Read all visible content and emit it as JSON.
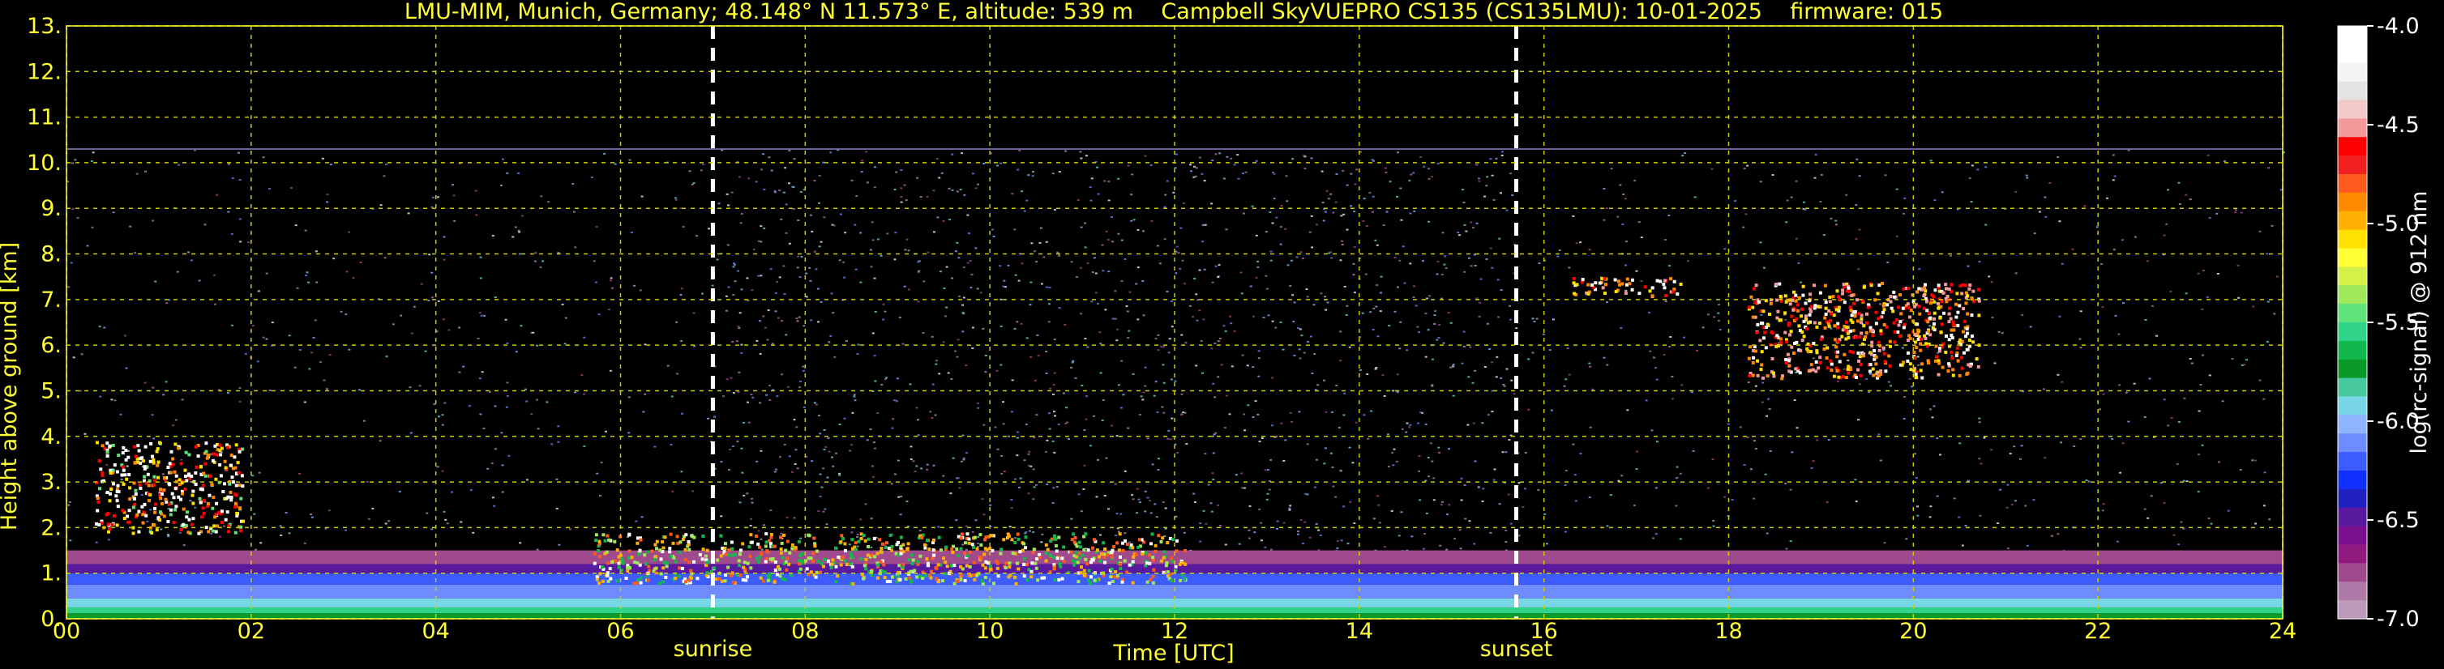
{
  "header": {
    "title": "LMU-MIM, Munich, Germany; 48.148° N 11.573° E, altitude: 539 m    Campbell SkyVUEPRO CS135 (CS135LMU): 10-01-2025    firmware: 015"
  },
  "chart_data": {
    "type": "heatmap",
    "title": "LMU-MIM, Munich, Germany; 48.148° N 11.573° E, altitude: 539 m    Campbell SkyVUEPRO CS135 (CS135LMU): 10-01-2025    firmware: 015",
    "xlabel": "Time [UTC]",
    "ylabel": "Height above ground [km]",
    "xlim": [
      0,
      24
    ],
    "ylim": [
      0,
      13
    ],
    "x_ticks": [
      0,
      2,
      4,
      6,
      8,
      10,
      12,
      14,
      16,
      18,
      20,
      22,
      24
    ],
    "x_tick_labels": [
      "00",
      "02",
      "04",
      "06",
      "08",
      "10",
      "12",
      "14",
      "16",
      "18",
      "20",
      "22",
      "24"
    ],
    "y_ticks": [
      0,
      1,
      2,
      3,
      4,
      5,
      6,
      7,
      8,
      9,
      10,
      11,
      12,
      13
    ],
    "y_tick_labels": [
      "0.",
      "1.",
      "2.",
      "3.",
      "4.",
      "5.",
      "6.",
      "7.",
      "8.",
      "9.",
      "10.",
      "11.",
      "12.",
      "13."
    ],
    "grid": true,
    "measurement_top_km": 10.3,
    "colorbar": {
      "label": "log(rc-signal) @ 912 nm",
      "min": -7.0,
      "max": -4.0,
      "ticks": [
        -4.0,
        -4.5,
        -5.0,
        -5.5,
        -6.0,
        -6.5,
        -7.0
      ],
      "tick_labels": [
        "-4.0",
        "-4.5",
        "-5.0",
        "-5.5",
        "-6.0",
        "-6.5",
        "-7.0"
      ],
      "colors_top_to_bottom": [
        "#ffffff",
        "#ffffff",
        "#f4f4f4",
        "#e3e3e3",
        "#f2c8c8",
        "#f49a9a",
        "#ff0000",
        "#f02020",
        "#ff5a1e",
        "#ff8a00",
        "#ffb000",
        "#ffe100",
        "#ffff33",
        "#d6f04a",
        "#9fe85a",
        "#5fe27a",
        "#2fd48a",
        "#12b84e",
        "#0a9a2a",
        "#47c89e",
        "#79d6e6",
        "#8fb4ff",
        "#6f8cff",
        "#3c5cff",
        "#1030ff",
        "#2020c0",
        "#5a1aa0",
        "#7a1090",
        "#901a80",
        "#a04a8e",
        "#b07aa8",
        "#bd9ab8"
      ]
    },
    "annotations": [
      {
        "label": "sunrise",
        "x": 7.0
      },
      {
        "label": "sunset",
        "x": 15.7
      }
    ],
    "features": [
      {
        "kind": "surface layer",
        "x_start": 0.0,
        "x_end": 24.0,
        "y_bottom": 0.0,
        "y_top": 1.5
      },
      {
        "kind": "low cloud",
        "x_start": 0.3,
        "x_end": 1.9,
        "y_bottom": 1.9,
        "y_top": 3.9
      },
      {
        "kind": "boundary layer cloud",
        "x_start": 5.7,
        "x_end": 12.1,
        "y_bottom": 0.8,
        "y_top": 1.9
      },
      {
        "kind": "mid-level cloud",
        "x_start": 16.3,
        "x_end": 17.5,
        "y_bottom": 7.1,
        "y_top": 7.5
      },
      {
        "kind": "mid-level cloud",
        "x_start": 18.2,
        "x_end": 20.7,
        "y_bottom": 5.3,
        "y_top": 7.4
      }
    ]
  }
}
